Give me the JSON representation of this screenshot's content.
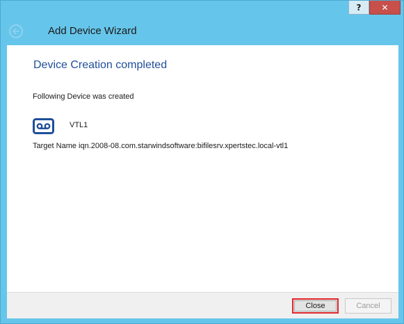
{
  "window": {
    "help_label": "?",
    "close_label": "✕"
  },
  "header": {
    "title": "Add Device Wizard",
    "back_icon": "back-arrow-icon"
  },
  "main": {
    "heading": "Device Creation completed",
    "description": "Following Device was created",
    "device": {
      "icon": "tape-cassette-icon",
      "name": "VTL1"
    },
    "target_label": "Target Name",
    "target_value": "iqn.2008-08.com.starwindsoftware:bifilesrv.xpertstec.local-vtl1"
  },
  "footer": {
    "close_label": "Close",
    "cancel_label": "Cancel"
  },
  "colors": {
    "frame": "#66c5ea",
    "heading": "#1f4e9a",
    "icon": "#1f4e9a",
    "focus_outline": "#e0262b"
  }
}
